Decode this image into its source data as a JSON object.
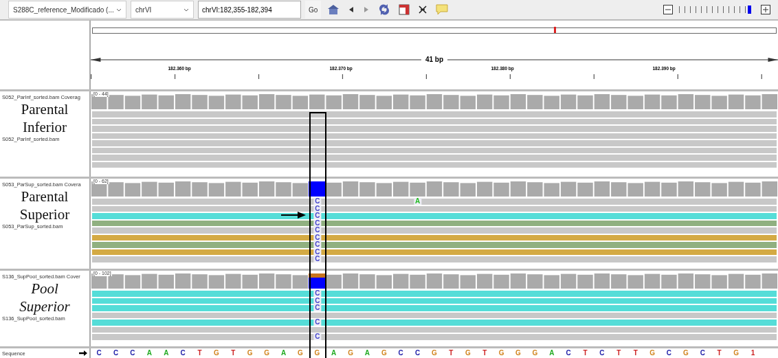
{
  "toolbar": {
    "genome": "S288C_reference_Modificado (...",
    "chromosome": "chrVI",
    "locus": "chrVI:182,355-182,394",
    "go": "Go",
    "zoom": {
      "level": 0.95
    }
  },
  "ruler": {
    "span": "41 bp",
    "ticks": [
      "182.360 bp",
      "182.370 bp",
      "182.380 bp",
      "182.390 bp"
    ]
  },
  "tracks": [
    {
      "coverage_label": "S052_ParInf_sorted.bam Coverag",
      "annotation": [
        "Parental",
        "Inferior"
      ],
      "italic": false,
      "range": "[0 - 44]",
      "reads_label": "S052_ParInf_sorted.bam",
      "reads": [
        {
          "color": "#c8c8c8"
        },
        {
          "color": "#c8c8c8"
        },
        {
          "color": "#c8c8c8"
        },
        {
          "color": "#c8c8c8"
        },
        {
          "color": "#c8c8c8"
        },
        {
          "color": "#c8c8c8"
        },
        {
          "color": "#c8c8c8"
        },
        {
          "color": "#c8c8c8"
        }
      ]
    },
    {
      "coverage_label": "S053_ParSup_sorted.bam Covera",
      "annotation": [
        "Parental",
        "Superior"
      ],
      "italic": false,
      "range": "[0 - 62]",
      "reads_label": "S053_ParSup_sorted.bam",
      "variant": [
        {
          "color": "#0000ff"
        }
      ],
      "arrow": true,
      "reads": [
        {
          "color": "#c8c8c8",
          "mismatches": [
            {
              "kind": "variant",
              "base": "C",
              "color": "#4444cc"
            },
            {
              "kind": "other",
              "base": "A",
              "color": "#22bb22"
            }
          ]
        },
        {
          "color": "#c8c8c8",
          "mismatches": [
            {
              "kind": "variant",
              "base": "C",
              "color": "#4444cc"
            }
          ]
        },
        {
          "color": "#55ddd8",
          "mismatches": [
            {
              "kind": "variant",
              "base": "C",
              "color": "#4444cc"
            }
          ]
        },
        {
          "color": "#90b080",
          "mismatches": [
            {
              "kind": "variant",
              "base": "C",
              "color": "#4444cc"
            }
          ]
        },
        {
          "color": "#c8c8c8",
          "mismatches": [
            {
              "kind": "variant",
              "base": "C",
              "color": "#4444cc"
            }
          ]
        },
        {
          "color": "#d4aa44",
          "mismatches": [
            {
              "kind": "variant",
              "base": "C",
              "color": "#4444cc"
            }
          ]
        },
        {
          "color": "#90b080",
          "mismatches": [
            {
              "kind": "variant",
              "base": "C",
              "color": "#4444cc"
            }
          ]
        },
        {
          "color": "#d4aa44",
          "mismatches": [
            {
              "kind": "variant",
              "base": "C",
              "color": "#4444cc"
            }
          ]
        },
        {
          "color": "#c8c8c8",
          "mismatches": [
            {
              "kind": "variant",
              "base": "C",
              "color": "#4444cc"
            }
          ]
        }
      ]
    },
    {
      "coverage_label": "S136_SupPool_sorted.bam Cover",
      "annotation": [
        "Pool",
        "Superior"
      ],
      "italic": true,
      "range": "[0 - 102]",
      "reads_label": "S136_SupPool_sorted.bam",
      "variant": [
        {
          "color": "#c8741e"
        },
        {
          "color": "#0000ff"
        }
      ],
      "reads": [
        {
          "color": "#55ddd8",
          "mismatches": [
            {
              "kind": "variant",
              "base": "C",
              "color": "#4444cc"
            }
          ]
        },
        {
          "color": "#55ddd8",
          "mismatches": [
            {
              "kind": "variant",
              "base": "C",
              "color": "#4444cc"
            }
          ]
        },
        {
          "color": "#55ddd8",
          "mismatches": [
            {
              "kind": "variant",
              "base": "C",
              "color": "#4444cc"
            }
          ]
        },
        {
          "color": "#c8c8c8"
        },
        {
          "color": "#55ddd8",
          "mismatches": [
            {
              "kind": "variant",
              "base": "C",
              "color": "#4444cc"
            }
          ]
        },
        {
          "color": "#c8c8c8"
        },
        {
          "color": "#c8c8c8",
          "mismatches": [
            {
              "kind": "variant",
              "base": "C",
              "color": "#4444cc"
            }
          ]
        }
      ]
    }
  ],
  "sequence": {
    "label": "Sequence",
    "bases": [
      {
        "base": "C",
        "color": "#2222aa"
      },
      {
        "base": "C",
        "color": "#2222aa"
      },
      {
        "base": "C",
        "color": "#2222aa"
      },
      {
        "base": "A",
        "color": "#22aa22"
      },
      {
        "base": "A",
        "color": "#22aa22"
      },
      {
        "base": "C",
        "color": "#2222aa"
      },
      {
        "base": "T",
        "color": "#cc2222"
      },
      {
        "base": "G",
        "color": "#d1841e"
      },
      {
        "base": "T",
        "color": "#cc2222"
      },
      {
        "base": "G",
        "color": "#d1841e"
      },
      {
        "base": "G",
        "color": "#d1841e"
      },
      {
        "base": "A",
        "color": "#22aa22"
      },
      {
        "base": "G",
        "color": "#d1841e"
      },
      {
        "base": "G",
        "color": "#d1841e"
      },
      {
        "base": "A",
        "color": "#22aa22"
      },
      {
        "base": "G",
        "color": "#d1841e"
      },
      {
        "base": "A",
        "color": "#22aa22"
      },
      {
        "base": "G",
        "color": "#d1841e"
      },
      {
        "base": "C",
        "color": "#2222aa"
      },
      {
        "base": "C",
        "color": "#2222aa"
      },
      {
        "base": "G",
        "color": "#d1841e"
      },
      {
        "base": "T",
        "color": "#cc2222"
      },
      {
        "base": "G",
        "color": "#d1841e"
      },
      {
        "base": "T",
        "color": "#cc2222"
      },
      {
        "base": "G",
        "color": "#d1841e"
      },
      {
        "base": "G",
        "color": "#d1841e"
      },
      {
        "base": "G",
        "color": "#d1841e"
      },
      {
        "base": "A",
        "color": "#22aa22"
      },
      {
        "base": "C",
        "color": "#2222aa"
      },
      {
        "base": "T",
        "color": "#cc2222"
      },
      {
        "base": "C",
        "color": "#2222aa"
      },
      {
        "base": "T",
        "color": "#cc2222"
      },
      {
        "base": "T",
        "color": "#cc2222"
      },
      {
        "base": "G",
        "color": "#d1841e"
      },
      {
        "base": "C",
        "color": "#2222aa"
      },
      {
        "base": "G",
        "color": "#d1841e"
      },
      {
        "base": "C",
        "color": "#2222aa"
      },
      {
        "base": "T",
        "color": "#cc2222"
      },
      {
        "base": "G",
        "color": "#d1841e"
      },
      {
        "base": "1",
        "color": "#cc2222"
      }
    ]
  }
}
